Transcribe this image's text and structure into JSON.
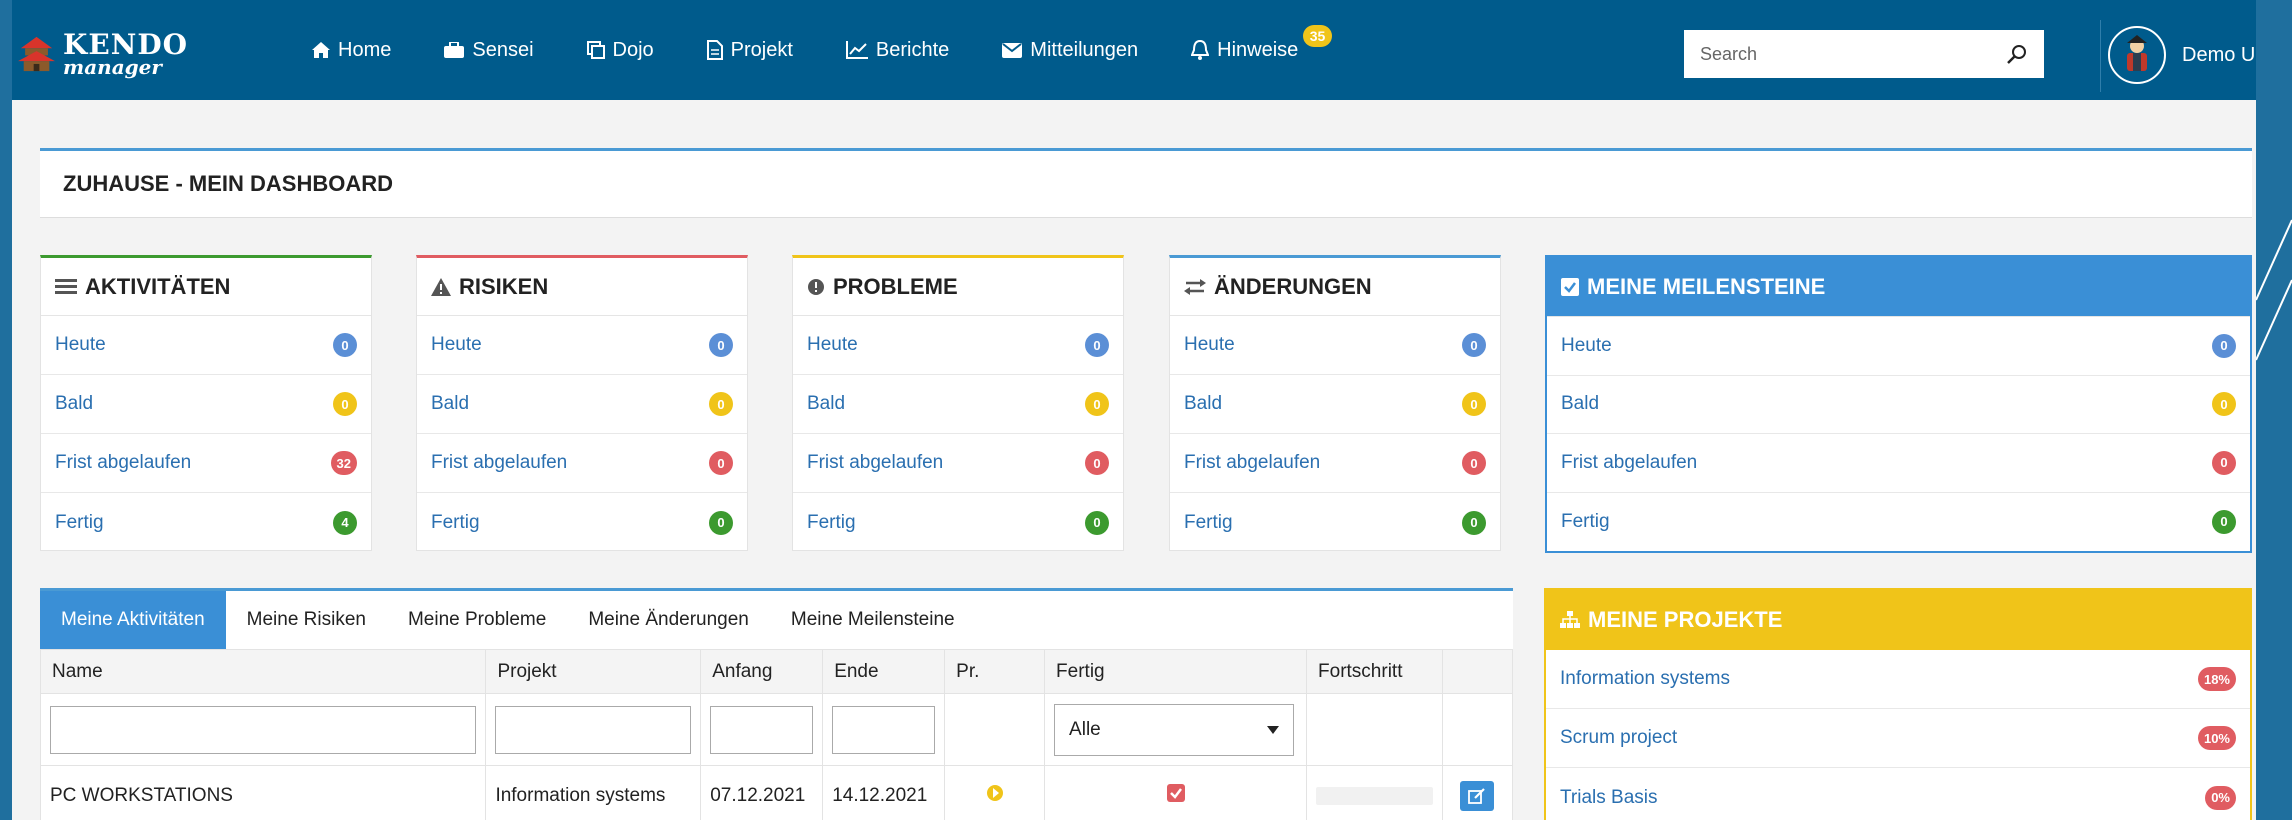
{
  "nav": {
    "logo_line1": "KENDO",
    "logo_line2": "manager",
    "items": [
      {
        "label": "Home",
        "icon": "home-icon"
      },
      {
        "label": "Sensei",
        "icon": "briefcase-icon"
      },
      {
        "label": "Dojo",
        "icon": "copy-icon"
      },
      {
        "label": "Projekt",
        "icon": "document-icon"
      },
      {
        "label": "Berichte",
        "icon": "line-chart-icon"
      },
      {
        "label": "Mitteilungen",
        "icon": "envelope-icon"
      },
      {
        "label": "Hinweise",
        "icon": "bell-icon",
        "badge": "35"
      }
    ],
    "search_placeholder": "Search",
    "user_name": "Demo User"
  },
  "page": {
    "title": "ZUHAUSE - MEIN DASHBOARD"
  },
  "panels": [
    {
      "title": "AKTIVITÄTEN",
      "accent": "#3c9a2f",
      "rows": [
        {
          "label": "Heute",
          "count": "0",
          "color": "blue"
        },
        {
          "label": "Bald",
          "count": "0",
          "color": "yellow"
        },
        {
          "label": "Frist abgelaufen",
          "count": "32",
          "color": "red"
        },
        {
          "label": "Fertig",
          "count": "4",
          "color": "green"
        }
      ]
    },
    {
      "title": "RISIKEN",
      "accent": "#e05c61",
      "rows": [
        {
          "label": "Heute",
          "count": "0",
          "color": "blue"
        },
        {
          "label": "Bald",
          "count": "0",
          "color": "yellow"
        },
        {
          "label": "Frist abgelaufen",
          "count": "0",
          "color": "red"
        },
        {
          "label": "Fertig",
          "count": "0",
          "color": "green"
        }
      ]
    },
    {
      "title": "PROBLEME",
      "accent": "#f0c419",
      "rows": [
        {
          "label": "Heute",
          "count": "0",
          "color": "blue"
        },
        {
          "label": "Bald",
          "count": "0",
          "color": "yellow"
        },
        {
          "label": "Frist abgelaufen",
          "count": "0",
          "color": "red"
        },
        {
          "label": "Fertig",
          "count": "0",
          "color": "green"
        }
      ]
    },
    {
      "title": "ÄNDERUNGEN",
      "accent": "#4a9ad4",
      "rows": [
        {
          "label": "Heute",
          "count": "0",
          "color": "blue"
        },
        {
          "label": "Bald",
          "count": "0",
          "color": "yellow"
        },
        {
          "label": "Frist abgelaufen",
          "count": "0",
          "color": "red"
        },
        {
          "label": "Fertig",
          "count": "0",
          "color": "green"
        }
      ]
    }
  ],
  "milestones": {
    "title": "MEINE MEILENSTEINE",
    "rows": [
      {
        "label": "Heute",
        "count": "0",
        "color": "blue"
      },
      {
        "label": "Bald",
        "count": "0",
        "color": "yellow"
      },
      {
        "label": "Frist abgelaufen",
        "count": "0",
        "color": "red"
      },
      {
        "label": "Fertig",
        "count": "0",
        "color": "green"
      }
    ]
  },
  "tabs": [
    "Meine Aktivitäten",
    "Meine Risiken",
    "Meine Probleme",
    "Meine Änderungen",
    "Meine Meilensteine"
  ],
  "table": {
    "headers": [
      "Name",
      "Projekt",
      "Anfang",
      "Ende",
      "Pr.",
      "Fertig",
      "Fortschritt",
      ""
    ],
    "filter_select_value": "Alle",
    "rows": [
      {
        "name": "PC WORKSTATIONS",
        "project": "Information systems",
        "start": "07.12.2021",
        "end": "14.12.2021",
        "priority_icon": "arrow-circle-right-icon",
        "done": true,
        "progress": 0
      }
    ]
  },
  "projects": {
    "title": "MEINE PROJEKTE",
    "rows": [
      {
        "label": "Information systems",
        "percent": "18%"
      },
      {
        "label": "Scrum project",
        "percent": "10%"
      },
      {
        "label": "Trials Basis",
        "percent": "0%"
      }
    ]
  },
  "colors": {
    "navbar": "#005b8c",
    "accent_blue": "#3a8fd6",
    "yellow": "#f0c419",
    "red": "#e05c61",
    "green": "#3c9a2f"
  }
}
